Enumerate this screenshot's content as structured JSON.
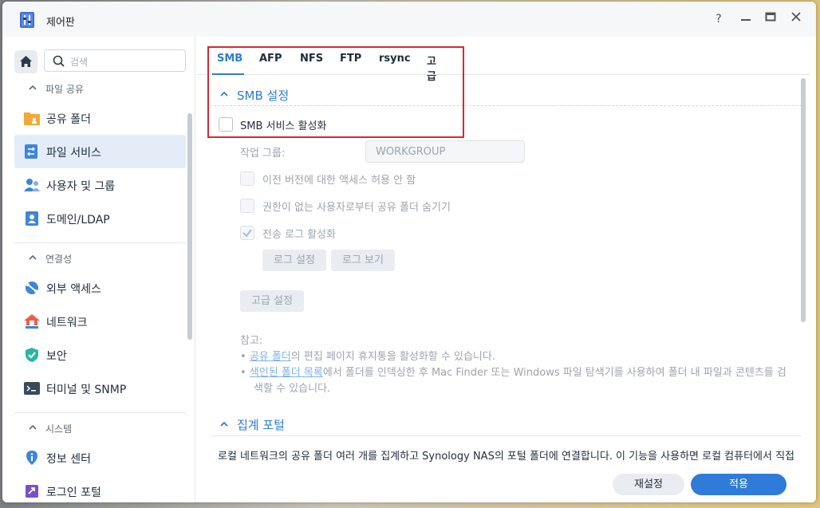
{
  "window": {
    "title": "제어판"
  },
  "title_buttons": {
    "help": "?",
    "minimize": "–",
    "maximize": "▭",
    "close": "✕"
  },
  "search": {
    "placeholder": "검색"
  },
  "sidebar": {
    "sections": [
      {
        "label": "파일 공유",
        "items": [
          {
            "label": "공유 폴더",
            "icon": "folder-icon"
          },
          {
            "label": "파일 서비스",
            "icon": "file-services-icon",
            "active": true
          },
          {
            "label": "사용자 및 그룹",
            "icon": "users-icon"
          },
          {
            "label": "도메인/LDAP",
            "icon": "domain-icon"
          }
        ]
      },
      {
        "label": "연결성",
        "items": [
          {
            "label": "외부 액세스",
            "icon": "external-access-icon"
          },
          {
            "label": "네트워크",
            "icon": "network-icon"
          },
          {
            "label": "보안",
            "icon": "shield-icon"
          },
          {
            "label": "터미널 및 SNMP",
            "icon": "terminal-icon"
          }
        ]
      },
      {
        "label": "시스템",
        "items": [
          {
            "label": "정보 센터",
            "icon": "info-icon"
          },
          {
            "label": "로그인 포털",
            "icon": "login-portal-icon"
          }
        ]
      }
    ]
  },
  "tabs": [
    "SMB",
    "AFP",
    "NFS",
    "FTP",
    "rsync",
    "고급"
  ],
  "smb": {
    "section_title": "SMB 설정",
    "enable_label": "SMB 서비스 활성화",
    "workgroup_label": "작업 그룹:",
    "workgroup_value": "WORKGROUP",
    "opt1": "이전 버전에 대한 액세스 허용 안 함",
    "opt2": "권한이 없는 사용자로부터 공유 폴더 숨기기",
    "opt3": "전송 로그 활성화",
    "log_settings": "로그 설정",
    "log_view": "로그 보기",
    "advanced": "고급 설정",
    "note_title": "참고:",
    "note1_link": "공유 폴더",
    "note1_rest": "의 편집 페이지 휴지통을 활성화할 수 있습니다.",
    "note2_link": "색인된 폴더 목록",
    "note2_rest": "에서 폴더를 인덱싱한 후 Mac Finder 또는 Windows 파일 탐색기를 사용하여 폴더 내 파일과 콘텐츠를 검",
    "note2_rest2": "색할 수 있습니다."
  },
  "aggregation": {
    "title": "집계 포털",
    "description": "로컬 네트워크의 공유 폴더 여러 개를 집계하고 Synology NAS의 포털 폴더에 연결합니다. 이 기능을 사용하면 로컬 컴퓨터에서 직접"
  },
  "footer": {
    "reset": "재설정",
    "apply": "적용"
  },
  "colors": {
    "accent": "#2f7bd9",
    "highlight": "#d7282f"
  }
}
